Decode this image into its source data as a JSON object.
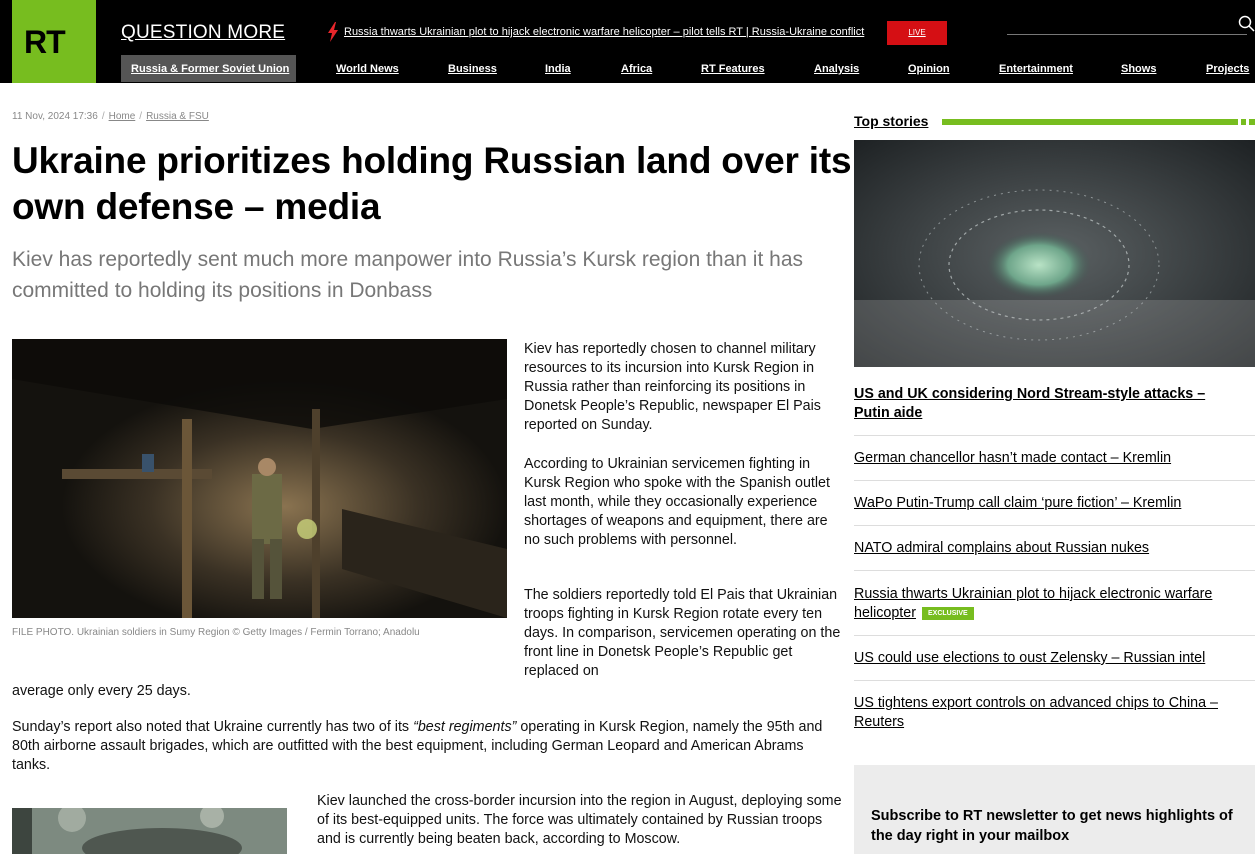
{
  "header": {
    "logo": "RT",
    "tagline": "QUESTION MORE",
    "ticker": "Russia thwarts Ukrainian plot to hijack electronic warfare helicopter – pilot tells RT | Russia-Ukraine conflict",
    "live_label": "LIVE",
    "nav": [
      "Russia & Former Soviet Union",
      "World News",
      "Business",
      "India",
      "Africa",
      "RT Features",
      "Analysis",
      "Opinion",
      "Entertainment",
      "Shows",
      "Projects"
    ],
    "accent_color": "#77bd1f",
    "live_color": "#d50f14"
  },
  "article": {
    "datetime": "11 Nov, 2024 17:36",
    "breadcrumb": [
      "Home",
      "Russia & FSU"
    ],
    "title": "Ukraine prioritizes holding Russian land over its own defense – media",
    "summary": "Kiev has reportedly sent much more manpower into Russia’s Kursk region than it has committed to holding its positions in Donbass",
    "photo_caption": "FILE PHOTO. Ukrainian soldiers in Sumy Region © Getty Images / Fermin Torrano;  Anadolu",
    "paragraphs": {
      "p1": "Kiev has reportedly chosen to channel military resources to its incursion into Kursk Region in Russia rather than reinforcing its positions in Donetsk People’s Republic, newspaper El Pais reported on Sunday.",
      "p2": "According to Ukrainian servicemen fighting in Kursk Region who spoke with the Spanish outlet last month, while they occasionally experience shortages of weapons and equipment, there are no such problems with personnel.",
      "p3": "The soldiers reportedly told El Pais that Ukrainian troops fighting in Kursk Region rotate every ten days. In comparison, servicemen operating on the front line in Donetsk People’s Republic get replaced on",
      "p3_cont": "average only every 25 days.",
      "p4_before": "Sunday’s report also noted that Ukraine currently has two of its ",
      "p4_quote": "“best regiments”",
      "p4_after": " operating in Kursk Region, namely the 95th and 80th airborne assault brigades, which are outfitted with the best equipment, including German Leopard and American Abrams tanks.",
      "p5": "Kiev launched the cross-border incursion into the region in August, deploying some of its best-equipped units. The force was ultimately contained by Russian troops and is currently being beaten back, according to Moscow."
    }
  },
  "sidebar": {
    "label": "Top stories",
    "lead": "US and UK considering Nord Stream-style attacks – Putin aide",
    "stories": [
      "German chancellor hasn’t made contact – Kremlin",
      "WaPo Putin-Trump call claim ‘pure fiction’ – Kremlin",
      "NATO admiral complains about Russian nukes",
      "Russia thwarts Ukrainian plot to hijack electronic warfare helicopter",
      "US could use elections to oust Zelensky – Russian intel",
      "US tightens export controls on advanced chips to China – Reuters"
    ],
    "exclusive_badge": "EXCLUSIVE",
    "newsletter": "Subscribe to RT newsletter to get news highlights of the day right in your mailbox"
  }
}
